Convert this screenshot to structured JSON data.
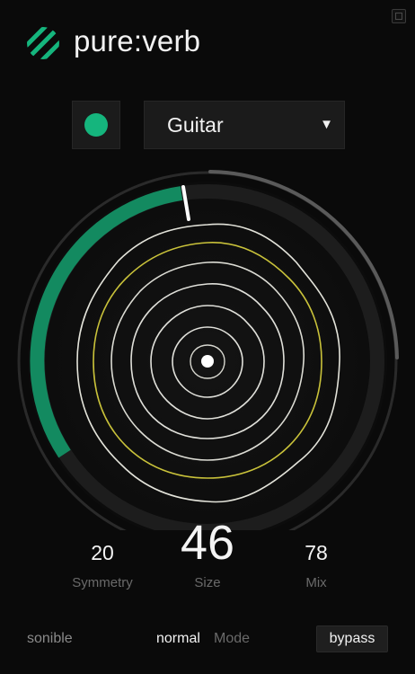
{
  "header": {
    "title": "pure:verb"
  },
  "preset": {
    "selected": "Guitar",
    "active": true
  },
  "params": {
    "symmetry": {
      "value": "20",
      "label": "Symmetry"
    },
    "size": {
      "value": "46",
      "label": "Size"
    },
    "mix": {
      "value": "78",
      "label": "Mix"
    }
  },
  "footer": {
    "brand": "sonible",
    "mode_value": "normal",
    "mode_label": "Mode",
    "bypass_label": "bypass"
  },
  "colors": {
    "accent": "#15b57d",
    "ring_yellow": "#c9c23a",
    "ring_light": "#e3e3da",
    "background": "#0a0a0a"
  },
  "icons": {
    "logo": "pure-verb-logo-icon",
    "dropdown": "triangle-down-icon"
  }
}
